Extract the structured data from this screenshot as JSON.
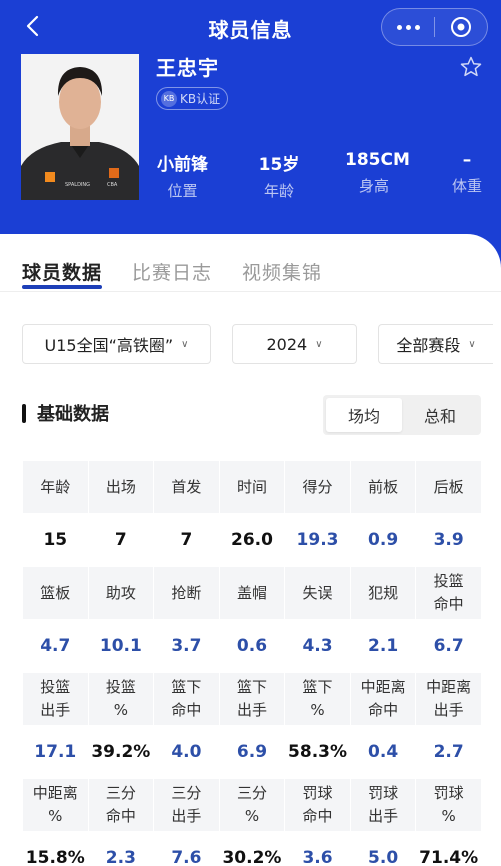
{
  "header": {
    "title": "球员信息",
    "name": "王忠宇",
    "kb_badge": "KB认证",
    "kb_icon_text": "KB",
    "stats": [
      {
        "value": "小前锋",
        "label": "位置"
      },
      {
        "value": "15岁",
        "label": "年龄"
      },
      {
        "value": "185CM",
        "label": "身高"
      },
      {
        "value": "–",
        "label": "体重"
      }
    ],
    "jersey_texts": [
      "SPALDING",
      "CBA"
    ]
  },
  "tabs": [
    "球员数据",
    "比赛日志",
    "视频集锦"
  ],
  "filters": [
    "U15全国“高铁圈”",
    "2024",
    "全部赛段"
  ],
  "section": {
    "title": "基础数据",
    "toggle": [
      "场均",
      "总和"
    ],
    "selected": "场均"
  },
  "table": [
    {
      "headers": [
        "年龄",
        "出场",
        "首发",
        "时间",
        "得分",
        "前板",
        "后板"
      ],
      "values": [
        "15",
        "7",
        "7",
        "26.0",
        "19.3",
        "0.9",
        "3.9"
      ]
    },
    {
      "headers": [
        "篮板",
        "助攻",
        "抢断",
        "盖帽",
        "失误",
        "犯规",
        "投篮 命中"
      ],
      "values": [
        "4.7",
        "10.1",
        "3.7",
        "0.6",
        "4.3",
        "2.1",
        "6.7"
      ]
    },
    {
      "headers": [
        "投篮 出手",
        "投篮 %",
        "篮下 命中",
        "篮下 出手",
        "篮下 %",
        "中距离 命中",
        "中距离 出手"
      ],
      "values": [
        "17.1",
        "39.2%",
        "4.0",
        "6.9",
        "58.3%",
        "0.4",
        "2.7"
      ]
    },
    {
      "headers": [
        "中距离 %",
        "三分 命中",
        "三分 出手",
        "三分 %",
        "罚球 命中",
        "罚球 出手",
        "罚球 %"
      ],
      "values": [
        "15.8%",
        "2.3",
        "7.6",
        "30.2%",
        "3.6",
        "5.0",
        "71.4%"
      ]
    }
  ],
  "colors": {
    "brand": "#1b3fd4",
    "value_blue": "#2d4fa8",
    "tab_underline": "#1d3fb8"
  }
}
